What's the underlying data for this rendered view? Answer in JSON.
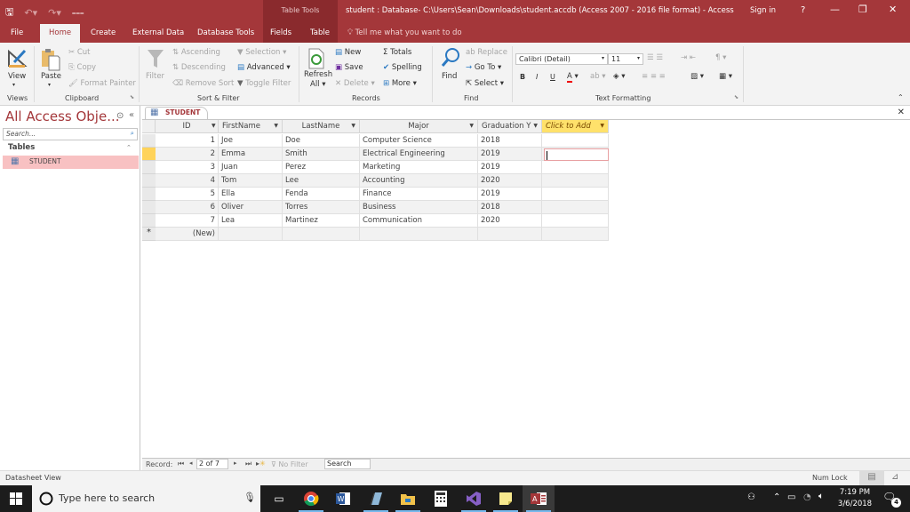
{
  "titlebar": {
    "context_group": "Table Tools",
    "title": "student : Database- C:\\Users\\Sean\\Downloads\\student.accdb (Access 2007 - 2016 file format)  -  Access",
    "sign_in": "Sign in",
    "help": "?",
    "minimize": "—",
    "restore": "❐",
    "close": "✕"
  },
  "tabs": {
    "items": [
      "File",
      "Home",
      "Create",
      "External Data",
      "Database Tools",
      "Fields",
      "Table"
    ],
    "active": "Home",
    "tell_me": "Tell me what you want to do"
  },
  "ribbon": {
    "views": {
      "view": "View",
      "group": "Views"
    },
    "clipboard": {
      "paste": "Paste",
      "cut": "Cut",
      "copy": "Copy",
      "format_painter": "Format Painter",
      "group": "Clipboard"
    },
    "sort_filter": {
      "filter": "Filter",
      "ascending": "Ascending",
      "descending": "Descending",
      "remove_sort": "Remove Sort",
      "selection": "Selection",
      "advanced": "Advanced",
      "toggle_filter": "Toggle Filter",
      "group": "Sort & Filter"
    },
    "records": {
      "refresh_all": "Refresh",
      "refresh_all2": "All",
      "new": "New",
      "save": "Save",
      "delete": "Delete",
      "totals": "Totals",
      "spelling": "Spelling",
      "more": "More",
      "group": "Records"
    },
    "find": {
      "find": "Find",
      "replace": "Replace",
      "go_to": "Go To",
      "select": "Select",
      "group": "Find"
    },
    "text_formatting": {
      "font": "Calibri (Detail)",
      "size": "11",
      "bold": "B",
      "italic": "I",
      "underline": "U",
      "group": "Text Formatting"
    }
  },
  "nav": {
    "title": "All Access Obje...",
    "search_placeholder": "Search...",
    "group": "Tables",
    "items": [
      "STUDENT"
    ]
  },
  "doc": {
    "tab": "STUDENT",
    "columns": [
      "ID",
      "FirstName",
      "LastName",
      "Major",
      "Graduation Y",
      "Click to Add"
    ],
    "rows": [
      [
        "1",
        "Joe",
        "Doe",
        "Computer Science",
        "2018"
      ],
      [
        "2",
        "Emma",
        "Smith",
        "Electrical Engineering",
        "2019"
      ],
      [
        "3",
        "Juan",
        "Perez",
        "Marketing",
        "2019"
      ],
      [
        "4",
        "Tom",
        "Lee",
        "Accounting",
        "2020"
      ],
      [
        "5",
        "Ella",
        "Fenda",
        "Finance",
        "2019"
      ],
      [
        "6",
        "Oliver",
        "Torres",
        "Business",
        "2018"
      ],
      [
        "7",
        "Lea",
        "Martinez",
        "Communication",
        "2020"
      ]
    ],
    "new_row": "(New)",
    "new_row_marker": "*",
    "selected_row": 2
  },
  "record_nav": {
    "label": "Record:",
    "position": "2 of 7",
    "filter": "No Filter",
    "search": "Search"
  },
  "status": {
    "view": "Datasheet View",
    "num_lock": "Num Lock"
  },
  "taskbar": {
    "search_placeholder": "Type here to search",
    "time": "7:19 PM",
    "date": "3/6/2018",
    "notifications": "4",
    "apps": [
      "chrome",
      "word",
      "notepad",
      "file-explorer",
      "calculator",
      "visual-studio",
      "sticky-notes",
      "access"
    ]
  },
  "colors": {
    "accent": "#a4373a",
    "context": "#8a2a2d",
    "selected_nav": "#f8c1c2",
    "click_to_add": "#ffe16b"
  }
}
